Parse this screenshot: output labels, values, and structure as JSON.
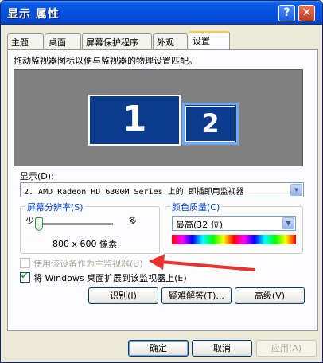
{
  "window": {
    "title": "显示 属性",
    "help_label": "?",
    "close_label": "✕"
  },
  "tabs": [
    {
      "label": "主题",
      "active": false
    },
    {
      "label": "桌面",
      "active": false
    },
    {
      "label": "屏幕保护程序",
      "active": false
    },
    {
      "label": "外观",
      "active": false
    },
    {
      "label": "设置",
      "active": true
    }
  ],
  "settings": {
    "instruction": "拖动监视器图标以便与监视器的物理设置匹配。",
    "monitors": [
      {
        "number": "1"
      },
      {
        "number": "2"
      }
    ],
    "display_label": "显示(D):",
    "display_value": "2. AMD Radeon HD 6300M Series 上的 即插即用监视器",
    "resolution": {
      "legend": "屏幕分辨率(S)",
      "min_label": "少",
      "max_label": "多",
      "value": "800 x 600 像素",
      "slider_level": 0
    },
    "color_quality": {
      "legend": "颜色质量(C)",
      "value": "最高(32 位)"
    },
    "primary_checkbox": {
      "label": "使用该设备作为主监视器(U)",
      "checked": false,
      "disabled": true
    },
    "extend_checkbox": {
      "label": "将 Windows 桌面扩展到该监视器上(E)",
      "checked": true
    },
    "buttons": {
      "identify": "识别(I)",
      "troubleshoot": "疑难解答(T)...",
      "advanced": "高级(V)"
    }
  },
  "footer": {
    "ok": "确定",
    "cancel": "取消",
    "apply": "应用(A)"
  },
  "colors": {
    "title_bar": "#0452de",
    "monitor_fill": "#0b3b8c",
    "arrow": "#e8322b"
  }
}
